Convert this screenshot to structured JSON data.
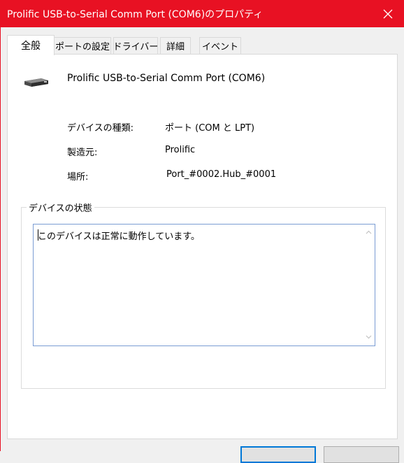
{
  "window": {
    "title": "Prolific USB-to-Serial Comm Port (COM6)のプロパティ",
    "accent_color": "#e81123"
  },
  "tabs": [
    {
      "label": "全般",
      "active": true
    },
    {
      "label": "ポートの設定",
      "active": false
    },
    {
      "label": "ドライバー",
      "active": false
    },
    {
      "label": "詳細",
      "active": false
    },
    {
      "label": "イベント",
      "active": false
    }
  ],
  "general": {
    "device_name": "Prolific USB-to-Serial Comm Port (COM6)",
    "device_icon": "serial-port-icon",
    "properties": [
      {
        "label": "デバイスの種類:",
        "value": "ポート (COM と LPT)"
      },
      {
        "label": "製造元:",
        "value": "Prolific"
      },
      {
        "label": "場所:",
        "value": "Port_#0002.Hub_#0001"
      }
    ],
    "status": {
      "legend": "デバイスの状態",
      "text": "このデバイスは正常に動作しています。"
    }
  }
}
